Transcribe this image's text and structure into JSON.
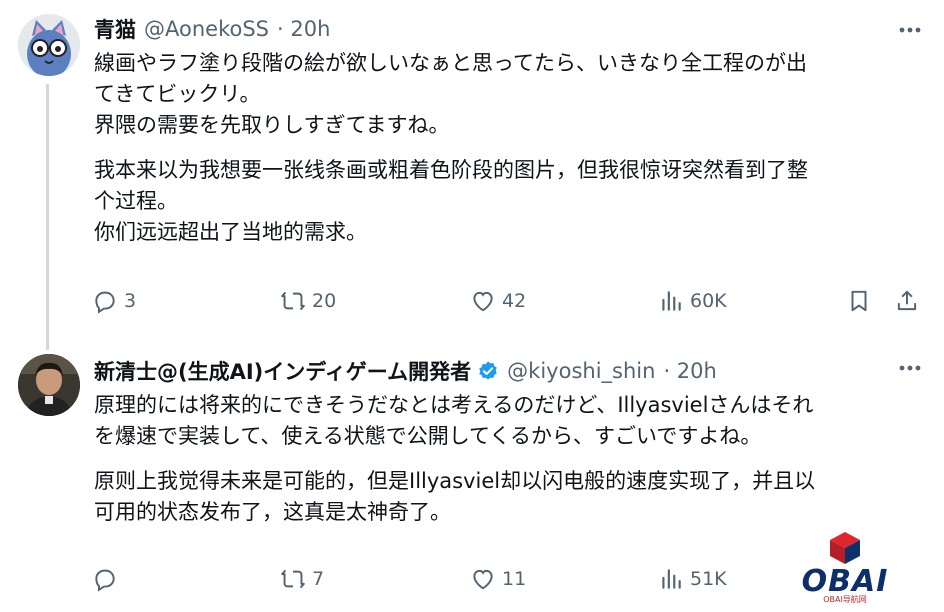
{
  "tweets": [
    {
      "display_name": "青猫",
      "handle": "@AonekoSS",
      "time": "· 20h",
      "paragraphs": [
        [
          "線画やラフ塗り段階の絵が欲しいなぁと思ってたら、いきなり全工程のが出",
          "てきてビックリ。",
          "界隈の需要を先取りしすぎてますね。"
        ],
        [
          "我本来以为我想要一张线条画或粗着色阶段的图片，但我很惊讶突然看到了整",
          "个过程。",
          "你们远远超出了当地的需求。"
        ]
      ],
      "reply_count": "3",
      "retweet_count": "20",
      "like_count": "42",
      "view_count": "60K",
      "avatar_icon": "cat-with-glasses-avatar"
    },
    {
      "display_name": "新清士@(生成AI)インディゲーム開発者",
      "handle": "@kiyoshi_shin",
      "time": "· 20h",
      "paragraphs": [
        [
          "原理的には将来的にできそうだなとは考えるのだけど、Illyasvielさんはそれ",
          "を爆速で実装して、使える状態で公開してくるから、すごいですよね。"
        ],
        [
          "原则上我觉得未来是可能的，但是Illyasviel却以闪电般的速度实现了，并且以",
          "可用的状态发布了，这真是太神奇了。"
        ]
      ],
      "reply_count": "",
      "retweet_count": "7",
      "like_count": "11",
      "view_count": "51K",
      "avatar_icon": "person-photo-avatar"
    }
  ],
  "watermark": {
    "text": "OBAI",
    "sub": "OBAI导航网"
  },
  "colors": {
    "text": "#0f1419",
    "secondary": "#536471",
    "verified": "#1d9bf0",
    "thread_line": "#cfd9de"
  }
}
